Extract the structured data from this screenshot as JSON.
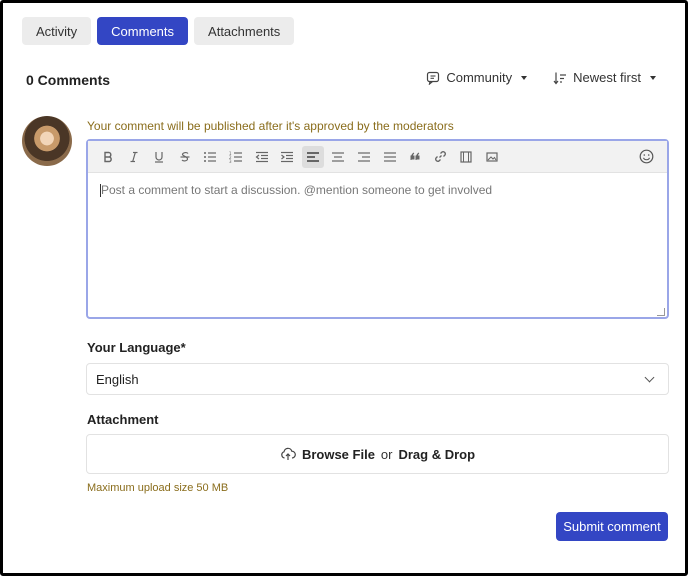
{
  "tabs": [
    {
      "label": "Activity",
      "active": false
    },
    {
      "label": "Comments",
      "active": true
    },
    {
      "label": "Attachments",
      "active": false
    }
  ],
  "comments": {
    "count_label": "0 Comments",
    "filter_visibility": "Community",
    "sort_order": "Newest first"
  },
  "editor": {
    "moderation_notice": "Your comment will be published after it's approved by the moderators",
    "placeholder": "Post a comment to start a discussion. @mention someone to get involved",
    "toolbar": [
      "bold-icon",
      "italic-icon",
      "underline-icon",
      "strikethrough-icon",
      "bullet-list-icon",
      "numbered-list-icon",
      "outdent-icon",
      "indent-icon",
      "align-left-icon",
      "align-center-icon",
      "align-right-icon",
      "align-justify-icon",
      "quote-icon",
      "link-icon",
      "video-icon",
      "image-icon"
    ],
    "active_tool": "align-left-icon"
  },
  "language": {
    "label": "Your Language",
    "required_mark": "*",
    "selected": "English"
  },
  "attachment": {
    "label": "Attachment",
    "browse_label": "Browse File",
    "or_text": "or",
    "drag_label": "Drag & Drop",
    "max_size": "Maximum upload size 50 MB"
  },
  "submit_label": "Submit comment",
  "colors": {
    "accent": "#3346c4",
    "notice": "#8a6d1c",
    "focus_border": "#9aa6e8"
  }
}
